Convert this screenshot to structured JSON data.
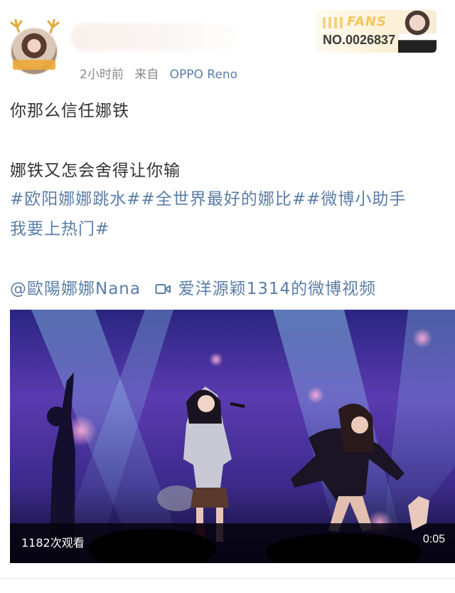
{
  "post": {
    "meta": {
      "time": "2小时前",
      "source_prefix": "来自",
      "device": "OPPO Reno"
    },
    "avatar_badge": "",
    "fans_badge": {
      "title": "FANS",
      "number": "NO.0026837"
    },
    "text": {
      "line1": "你那么信任娜铁",
      "line2": "娜铁又怎会舍得让你输",
      "hashtags_line1": "#欧阳娜娜跳水##全世界最好的娜比##微博小助手",
      "hashtags_line2": "我要上热门#",
      "mention": "@歐陽娜娜Nana",
      "video_link": "爱洋源颖1314的微博视频"
    },
    "video": {
      "views": "1182次观看",
      "duration": "0:05"
    }
  },
  "colors": {
    "link": "#5b7ea7",
    "text": "#333333",
    "meta": "#8a8a8a",
    "fans_gold": "#f3c65b"
  }
}
